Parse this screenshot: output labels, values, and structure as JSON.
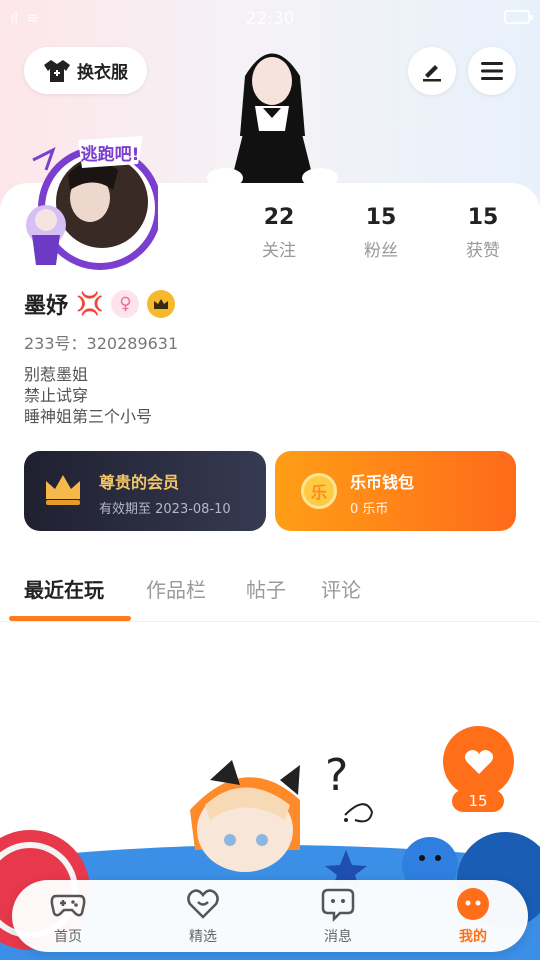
{
  "status_bar": {
    "time": "22:30",
    "signal": "ıl",
    "wifi": "≋"
  },
  "header": {
    "outfit_button_label": "换衣服"
  },
  "profile": {
    "username": "墨妤",
    "badge_text": "逃跑吧!",
    "uid_text": "233号：320289631",
    "bio_lines": [
      "别惹墨姐",
      "禁止试穿",
      "睡神姐第三个小号"
    ]
  },
  "stats": [
    {
      "value": "22",
      "label": "关注"
    },
    {
      "value": "15",
      "label": "粉丝"
    },
    {
      "value": "15",
      "label": "获赞"
    }
  ],
  "vip_card": {
    "title": "尊贵的会员",
    "subtitle": "有效期至 2023-08-10"
  },
  "wallet_card": {
    "title": "乐币钱包",
    "subtitle": "0 乐币",
    "coin_char": "乐"
  },
  "tabs": [
    {
      "label": "最近在玩",
      "active": true
    },
    {
      "label": "作品栏",
      "active": false
    },
    {
      "label": "帖子",
      "active": false
    },
    {
      "label": "评论",
      "active": false
    }
  ],
  "like": {
    "count": "15"
  },
  "bottom_nav": [
    {
      "label": "首页",
      "icon": "gamepad-icon"
    },
    {
      "label": "精选",
      "icon": "heart-outline-icon"
    },
    {
      "label": "消息",
      "icon": "chat-bubble-icon"
    },
    {
      "label": "我的",
      "icon": "profile-face-icon",
      "active": true
    }
  ],
  "colors": {
    "accent": "#ff6f1a",
    "vip_gold": "#f2c66a",
    "vip_bg": "#1f2030"
  }
}
